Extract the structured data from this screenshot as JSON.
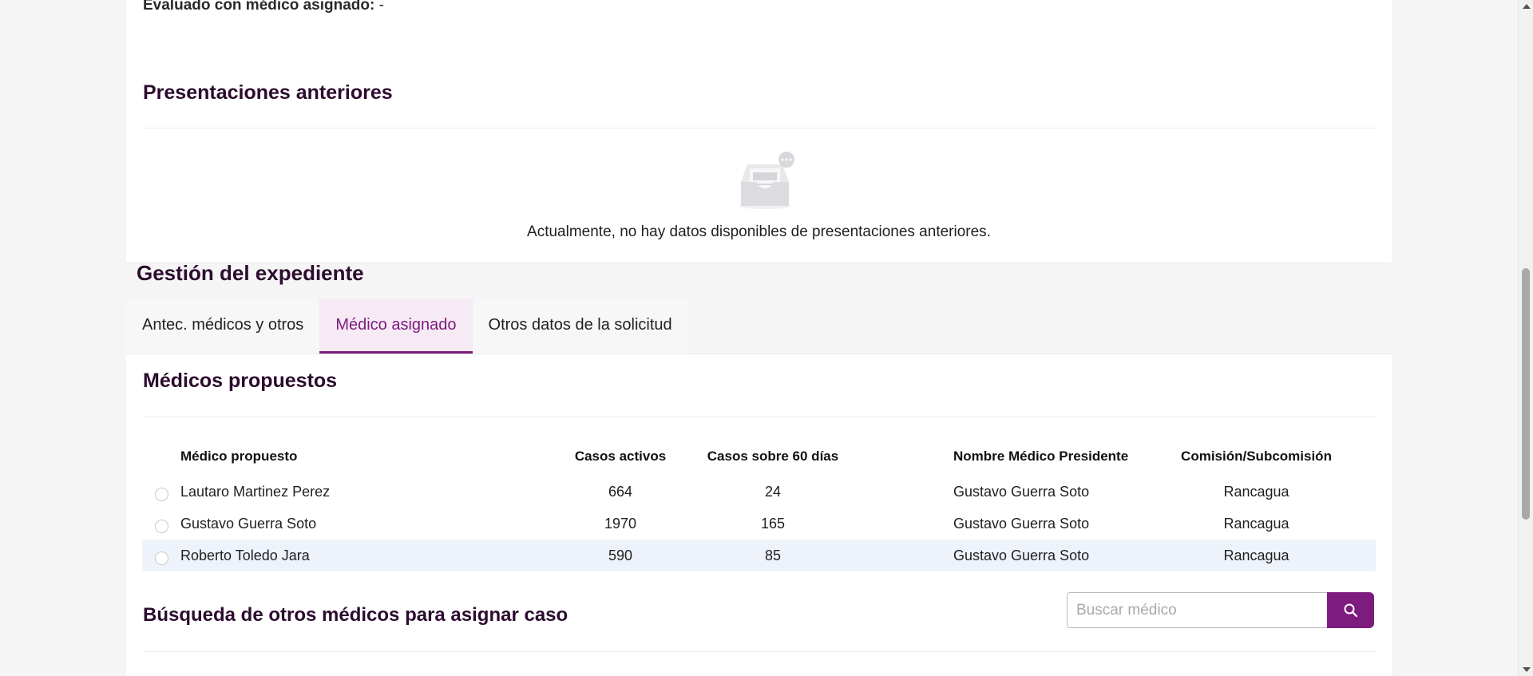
{
  "evaluado": {
    "label": "Evaluado con médico asignado:",
    "value": " -"
  },
  "presentaciones": {
    "title": "Presentaciones anteriores",
    "empty_message": "Actualmente, no hay datos disponibles de presentaciones anteriores."
  },
  "gestion": {
    "title": "Gestión del expediente",
    "tabs": [
      {
        "label": "Antec. médicos y otros",
        "active": false
      },
      {
        "label": "Médico asignado",
        "active": true
      },
      {
        "label": "Otros datos de la solicitud",
        "active": false
      }
    ]
  },
  "medicos_propuestos": {
    "title": "Médicos propuestos",
    "columns": [
      "Médico propuesto",
      "Casos activos",
      "Casos sobre 60 días",
      "Nombre Médico Presidente",
      "Comisión/Subcomisión"
    ],
    "rows": [
      {
        "medico": "Lautaro Martinez Perez",
        "activos": "664",
        "sobre60": "24",
        "presidente": "Gustavo Guerra Soto",
        "comision": "Rancagua"
      },
      {
        "medico": "Gustavo Guerra Soto",
        "activos": "1970",
        "sobre60": "165",
        "presidente": "Gustavo Guerra Soto",
        "comision": "Rancagua"
      },
      {
        "medico": "Roberto Toledo Jara",
        "activos": "590",
        "sobre60": "85",
        "presidente": "Gustavo Guerra Soto",
        "comision": "Rancagua"
      }
    ]
  },
  "busqueda": {
    "title": "Búsqueda de otros médicos para asignar caso",
    "placeholder": "Buscar médico",
    "value": ""
  },
  "colors": {
    "accent": "#7d1b7e",
    "heading": "#2b0b2e",
    "row_highlight": "#eef3fb"
  },
  "icons": {
    "search": "search-icon",
    "empty": "empty-inbox-icon"
  }
}
